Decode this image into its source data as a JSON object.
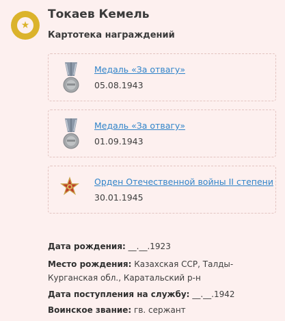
{
  "person": {
    "name": "Токаев Кемель"
  },
  "section_title": "Картотека награждений",
  "awards": [
    {
      "title": "Медаль «За отвагу»",
      "date": "05.08.1943",
      "icon": "medal-for-courage-icon"
    },
    {
      "title": "Медаль «За отвагу»",
      "date": "01.09.1943",
      "icon": "medal-for-courage-icon"
    },
    {
      "title": "Орден Отечественной войны II степени",
      "date": "30.01.1945",
      "icon": "order-patriotic-war-icon"
    }
  ],
  "details": {
    "birth_date_label": "Дата рождения:",
    "birth_date_value": "__.__.1923",
    "birth_place_label": "Место рождения:",
    "birth_place_value": "Казахская ССР, Талды-Курганская обл., Каратальский р-н",
    "service_start_label": "Дата поступления на службу:",
    "service_start_value": "__.__.1942",
    "rank_label": "Воинское звание:",
    "rank_value": "гв. сержант"
  },
  "colors": {
    "background": "#fdf0ef",
    "badge": "#dbb32b",
    "link": "#2f83c9"
  }
}
